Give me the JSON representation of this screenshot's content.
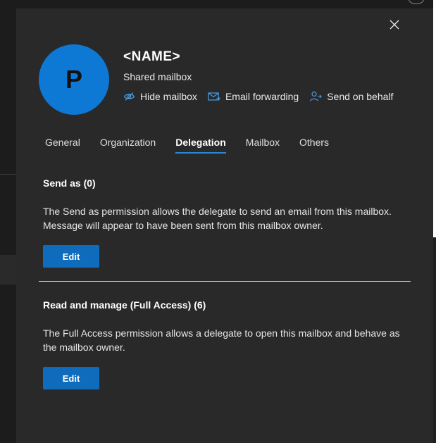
{
  "mailbox": {
    "avatar_initial": "P",
    "name": "<NAME>",
    "type": "Shared mailbox"
  },
  "actions": [
    {
      "label": "Hide mailbox",
      "icon": "hide-mailbox-icon"
    },
    {
      "label": "Email forwarding",
      "icon": "email-forwarding-icon"
    },
    {
      "label": "Send on behalf",
      "icon": "send-on-behalf-icon"
    }
  ],
  "tabs": [
    {
      "label": "General"
    },
    {
      "label": "Organization"
    },
    {
      "label": "Delegation",
      "active": true
    },
    {
      "label": "Mailbox"
    },
    {
      "label": "Others"
    }
  ],
  "sections": {
    "send_as": {
      "title": "Send as (0)",
      "description": "The Send as permission allows the delegate to send an email from this mailbox. Message will appear to have been sent from this mailbox owner.",
      "button": "Edit"
    },
    "full_access": {
      "title": "Read and manage (Full Access) (6)",
      "description": "The Full Access permission allows a delegate to open this mailbox and behave as the mailbox owner.",
      "button": "Edit"
    }
  },
  "colors": {
    "accent": "#0f6cbd",
    "avatar": "#0e78d5",
    "panel_bg": "#292929"
  }
}
